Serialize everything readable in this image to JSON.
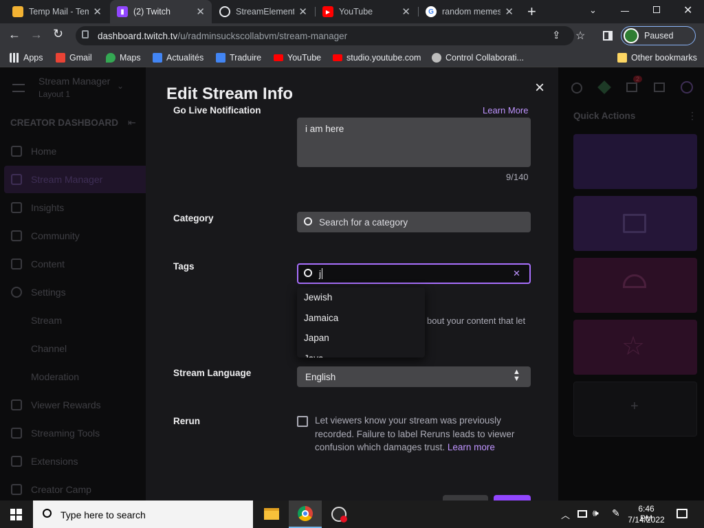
{
  "browser": {
    "tabs": [
      {
        "title": "Temp Mail - Tem",
        "favicon_color": "#f2b233",
        "active": false
      },
      {
        "title": "(2) Twitch",
        "favicon_color": "#9146ff",
        "active": true
      },
      {
        "title": "StreamElements",
        "favicon_color": "#e8eaed",
        "active": false
      },
      {
        "title": "YouTube",
        "favicon_color": "#ff0000",
        "active": false
      },
      {
        "title": "random memes",
        "favicon_color": "#ffffff",
        "active": false
      }
    ],
    "new_tab_label": "+",
    "url_domain": "dashboard.twitch.tv",
    "url_path": "/u/radminsuckscollabvm/stream-manager",
    "profile_status": "Paused",
    "bookmarks": [
      "Apps",
      "Gmail",
      "Maps",
      "Actualités",
      "Traduire",
      "YouTube",
      "studio.youtube.com",
      "Control Collaborati...",
      "Other bookmarks"
    ]
  },
  "sidebar": {
    "title": "Stream Manager",
    "subtitle": "Layout 1",
    "section": "CREATOR DASHBOARD",
    "items": [
      "Home",
      "Stream Manager",
      "Insights",
      "Community",
      "Content",
      "Settings",
      "Stream",
      "Channel",
      "Moderation",
      "Viewer Rewards",
      "Streaming Tools",
      "Extensions",
      "Creator Camp"
    ]
  },
  "quick_actions": {
    "title": "Quick Actions",
    "add_label": "+",
    "notification_count": "2"
  },
  "modal": {
    "title": "Edit Stream Info",
    "close_label": "×",
    "notification_label": "Go Live Notification",
    "learn_more_top": "Learn More",
    "notification_text": "i am here",
    "char_count": "9/140",
    "category_label": "Category",
    "category_placeholder": "Search for a category",
    "tags_label": "Tags",
    "tags_value": "j",
    "tags_helper_partial": "bout your content that let",
    "tag_options": [
      "Jewish",
      "Jamaica",
      "Japan",
      "Java"
    ],
    "language_label": "Stream Language",
    "language_value": "English",
    "rerun_label": "Rerun",
    "rerun_text": "Let viewers know your stream was previously recorded. Failure to label Reruns leads to viewer confusion which damages trust.",
    "rerun_learn_more": "Learn more"
  },
  "taskbar": {
    "search_placeholder": "Type here to search",
    "time": "6:46 PM",
    "date": "7/14/2022"
  },
  "colors": {
    "accent": "#9146ff",
    "link": "#bf94ff",
    "tab_active": "#35363a"
  }
}
